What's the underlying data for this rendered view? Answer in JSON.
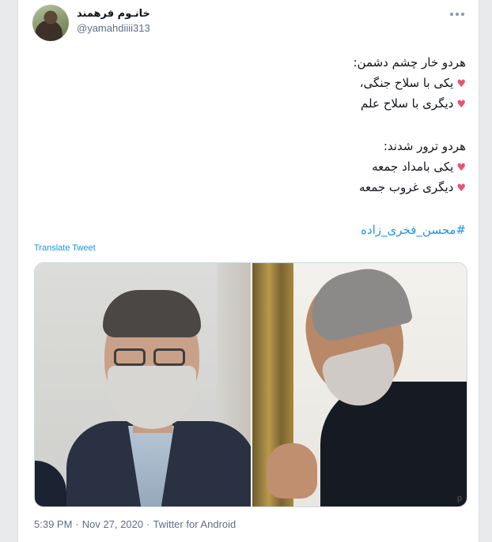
{
  "user": {
    "display_name": "خانـوم فرهمند",
    "handle": "@yamahdiiii313"
  },
  "tweet": {
    "lines": [
      {
        "text": "هردو خار چشم دشمن:",
        "heart": false
      },
      {
        "text": "یکی با سلاح جنگی،",
        "heart": true
      },
      {
        "text": "دیگری با سلاح علم",
        "heart": true
      },
      {
        "text": "هردو ترور شدند:",
        "heart": false
      },
      {
        "text": "یکی بامداد جمعه",
        "heart": true
      },
      {
        "text": "دیگری غروب جمعه",
        "heart": true
      }
    ],
    "heart_symbol": "♥",
    "hashtag": "#محسن_فخری_زاده",
    "translate_label": "Translate Tweet"
  },
  "media": {
    "watermark": "p"
  },
  "meta": {
    "time": "5:39 PM",
    "separator1": "·",
    "date": "Nov 27, 2020",
    "separator2": "·",
    "source": "Twitter for Android"
  },
  "colors": {
    "link": "#1b95e0",
    "heart": "#e8546f",
    "secondary_text": "#5b7083"
  },
  "icons": {
    "more": "more-horizontal-icon",
    "heart": "heart-icon"
  }
}
